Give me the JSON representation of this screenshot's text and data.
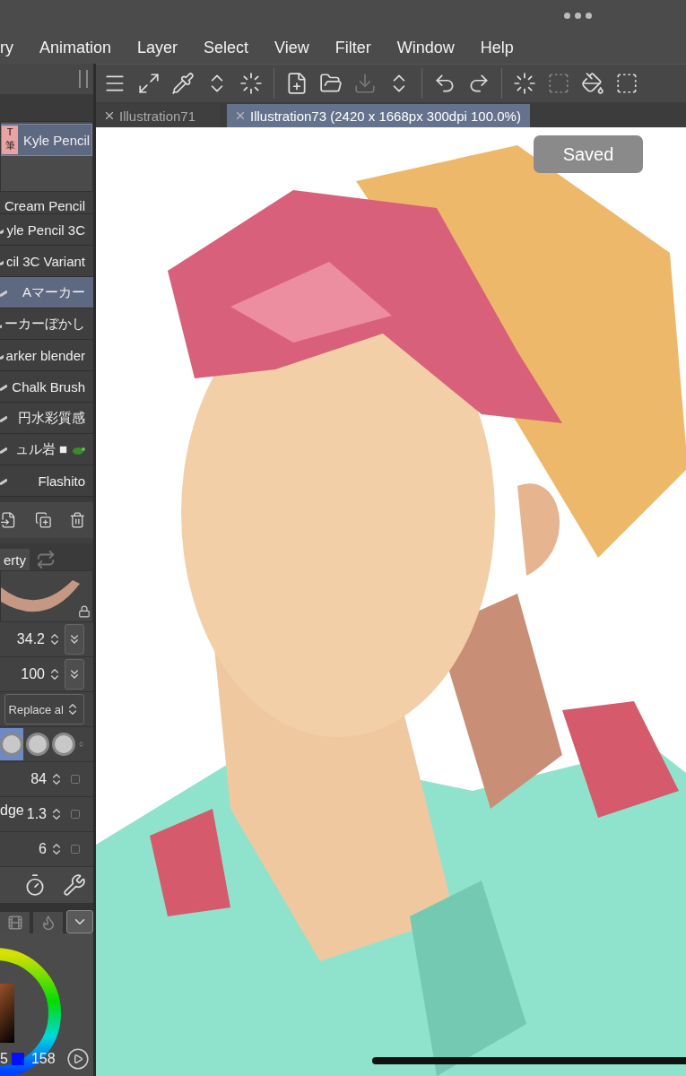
{
  "menu": [
    "ry",
    "Animation",
    "Layer",
    "Select",
    "View",
    "Filter",
    "Window",
    "Help"
  ],
  "tabs": [
    {
      "label": "Illustration71",
      "selected": false
    },
    {
      "label": "Illustration73 (2420 x 1668px 300dpi 100.0%)",
      "selected": true
    }
  ],
  "current_brush": {
    "badge_top": "T",
    "badge_bottom": "筆",
    "name": "Kyle Pencil"
  },
  "brushes": [
    {
      "name": "Cream Pencil",
      "selected": false
    },
    {
      "name": "yle Pencil 3C",
      "selected": false
    },
    {
      "name": "cil 3C Variant",
      "selected": false
    },
    {
      "name": "Aマーカー",
      "selected": true
    },
    {
      "name": "ーカーぼかし",
      "selected": false
    },
    {
      "name": "arker blender",
      "selected": false
    },
    {
      "name": "Chalk Brush",
      "selected": false
    },
    {
      "name": "円水彩質感",
      "selected": false
    },
    {
      "name": "ュル岩 ■",
      "selected": false
    },
    {
      "name": "Flashito",
      "selected": false
    }
  ],
  "property_tab": {
    "label": "erty",
    "selected": true
  },
  "properties": [
    {
      "kind": "number",
      "value": "34.2",
      "linked": true
    },
    {
      "kind": "number",
      "value": "100",
      "linked": true
    },
    {
      "kind": "dropdown",
      "value": "Replace al"
    },
    {
      "kind": "tips",
      "tips": [
        {
          "selected": true
        },
        {
          "selected": false
        },
        {
          "selected": false
        }
      ]
    },
    {
      "kind": "number",
      "value": "84",
      "linked": false
    },
    {
      "kind": "number",
      "label": "dge",
      "value": "1.3",
      "linked": false
    },
    {
      "kind": "number",
      "value": "6",
      "linked": false
    }
  ],
  "color": {
    "left_value": "5",
    "right_value": "158"
  },
  "toast": "Saved"
}
